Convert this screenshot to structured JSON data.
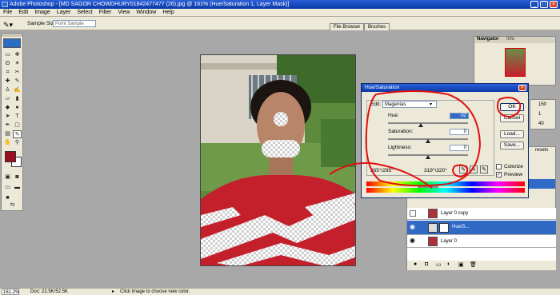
{
  "window": {
    "title": "Adobe Photoshop - [MD SAGOR CHOWDHURY01842477477 (26).jpg @ 161% (Hue/Saturation 1, Layer Mask)]"
  },
  "menu": [
    "File",
    "Edit",
    "Image",
    "Layer",
    "Select",
    "Filter",
    "View",
    "Window",
    "Help"
  ],
  "options": {
    "sample_size_label": "Sample Size:",
    "sample_size_value": "Point Sample"
  },
  "palette_well": [
    "File Browser",
    "Brushes"
  ],
  "navigator": {
    "tabs": [
      "Navigator",
      "Info"
    ]
  },
  "info_values": [
    "150",
    "1",
    "40"
  ],
  "layers_panel": {
    "tab_fragment": "resets",
    "rows": [
      {
        "name": "Layer 0 copy",
        "selected": false
      },
      {
        "name": "Hue/S...",
        "selected": true
      },
      {
        "name": "Layer 0",
        "selected": false
      }
    ]
  },
  "hue_saturation": {
    "title": "Hue/Saturation",
    "edit_label": "Edit:",
    "edit_value": "Magentas",
    "hue_label": "Hue:",
    "hue_value": "-32",
    "saturation_label": "Saturation:",
    "saturation_value": "0",
    "lightness_label": "Lightness:",
    "lightness_value": "0",
    "range_left": "265°/295°",
    "range_right": "319°\\320°",
    "buttons": {
      "ok": "OK",
      "cancel": "Cancel",
      "load": "Load...",
      "save": "Save..."
    },
    "colorize_label": "Colorize",
    "preview_label": "Preview",
    "preview_checked": true
  },
  "status": {
    "zoom": "161.2%",
    "doc": "Doc: 22.5K/52.5K",
    "hint": "Click image to choose new color."
  },
  "colors": {
    "foreground": "#9b1020",
    "background": "#ffffff",
    "annotation": "#e01010"
  }
}
